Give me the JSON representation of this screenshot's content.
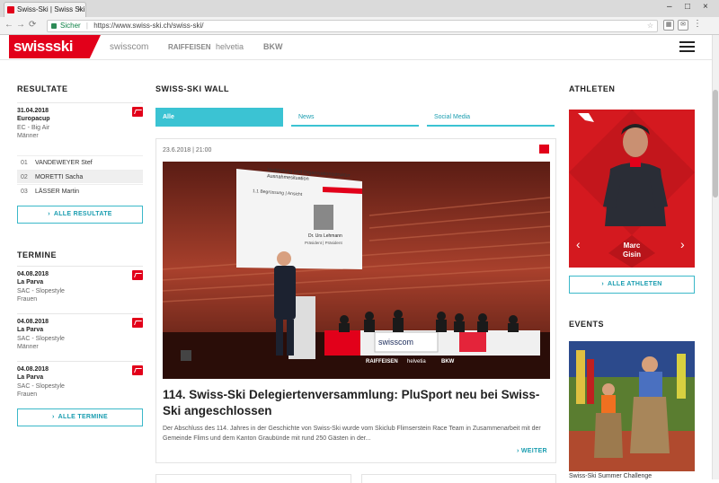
{
  "browser": {
    "tab_title": "Swiss-Ski | Swiss Ski",
    "tab_close": "×",
    "secure_label": "Sicher",
    "separator": "|",
    "url": "https://www.swiss-ski.ch/swiss-ski/",
    "window_controls": [
      "–",
      "□",
      "×"
    ]
  },
  "header": {
    "logo_text": "swissski",
    "sponsors": [
      "swisscom",
      "RAIFFEISEN",
      "helvetia",
      "BKW"
    ]
  },
  "left": {
    "results_title": "RESULTATE",
    "result": {
      "date": "31.04.2018",
      "name": "Europacup",
      "lines": [
        "EC - Big Air",
        "Männer"
      ]
    },
    "rankings": [
      {
        "rank": "01",
        "name": "VANDEWEYER Stef"
      },
      {
        "rank": "02",
        "name": "MORETTI Sacha"
      },
      {
        "rank": "03",
        "name": "LÄSSER Martin"
      }
    ],
    "results_button": "ALLE RESULTATE",
    "termine_title": "TERMINE",
    "termine": [
      {
        "date": "04.08.2018",
        "name": "La Parva",
        "lines": [
          "SAC - Slopestyle",
          "Frauen"
        ]
      },
      {
        "date": "04.08.2018",
        "name": "La Parva",
        "lines": [
          "SAC - Slopestyle",
          "Männer"
        ]
      },
      {
        "date": "04.08.2018",
        "name": "La Parva",
        "lines": [
          "SAC - Slopestyle",
          "Frauen"
        ]
      }
    ],
    "termine_button": "ALLE TERMINE"
  },
  "wall": {
    "title": "SWISS-SKI WALL",
    "tabs": [
      "Alle",
      "News",
      "Social Media"
    ],
    "card": {
      "time": "23.6.2018 | 21:00",
      "headline": "114. Swiss-Ski Delegiertenversammlung: PluSport neu bei Swiss-Ski angeschlossen",
      "excerpt": "Der Abschluss des 114. Jahres in der Geschichte von Swiss-Ski wurde vom Skiclub Flimserstein Race Team in Zusammenarbeit mit der Gemeinde Flims und dem Kanton Graubünde mit rund 250 Gästen in der...",
      "more": "WEITER"
    },
    "photo": {
      "slide_title": "Verbindung und Organisationsstruktur Ausnahmesituation",
      "slide_item": "1.1   Begrüssung | Ansicht",
      "speaker_name": "Dr. Urs Lehmann",
      "speaker_role": "Präsident | Präsident",
      "banners": [
        "swisscom",
        "RAIFFEISEN",
        "helvetia",
        "BKW"
      ]
    }
  },
  "athleten": {
    "title": "ATHLETEN",
    "first_name": "Marc",
    "last_name": "Gisin",
    "prev": "‹",
    "next": "›",
    "button": "ALLE ATHLETEN"
  },
  "events": {
    "title": "EVENTS",
    "caption": "Swiss-Ski Summer Challenge"
  },
  "colors": {
    "brand_red": "#e2001a",
    "accent_teal": "#3bc3d3"
  }
}
